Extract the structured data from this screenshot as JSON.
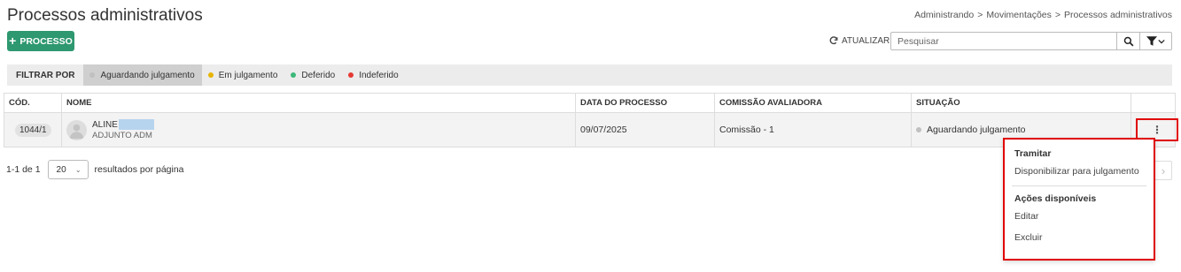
{
  "header": {
    "title": "Processos administrativos",
    "breadcrumb": [
      "Administrando",
      "Movimentações",
      "Processos administrativos"
    ]
  },
  "toolbar": {
    "new_label": "PROCESSO",
    "refresh_label": "ATUALIZAR",
    "search_placeholder": "Pesquisar"
  },
  "filters": {
    "label": "FILTRAR POR",
    "items": [
      {
        "label": "Aguardando julgamento",
        "color": "#c0c0c0",
        "active": true
      },
      {
        "label": "Em julgamento",
        "color": "#e6b400",
        "active": false
      },
      {
        "label": "Deferido",
        "color": "#3cb878",
        "active": false
      },
      {
        "label": "Indeferido",
        "color": "#e53935",
        "active": false
      }
    ]
  },
  "table": {
    "columns": [
      "CÓD.",
      "NOME",
      "DATA DO PROCESSO",
      "COMISSÃO AVALIADORA",
      "SITUAÇÃO",
      ""
    ],
    "rows": [
      {
        "code": "1044/1",
        "name": "ALINE",
        "role": "ADJUNTO ADM",
        "date": "09/07/2025",
        "committee": "Comissão - 1",
        "status": "Aguardando julgamento",
        "status_color": "#c0c0c0",
        "menu_icon": "kebab-menu-icon"
      }
    ]
  },
  "pagination": {
    "range": "1-1 de 1",
    "page_size": "20",
    "per_page_label": "resultados por página"
  },
  "context_menu": {
    "section1_title": "Tramitar",
    "section1_items": [
      "Disponibilizar para julgamento"
    ],
    "section2_title": "Ações disponíveis",
    "section2_items": [
      "Editar",
      "Excluir"
    ]
  },
  "colors": {
    "primary": "#2e9870",
    "highlight": "#e00000"
  }
}
